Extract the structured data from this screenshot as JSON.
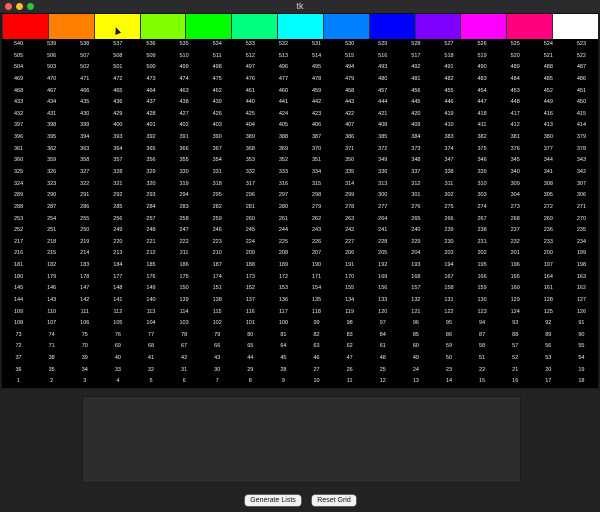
{
  "window": {
    "title": "tk"
  },
  "palette": [
    {
      "name": "red",
      "color": "#ff0000"
    },
    {
      "name": "orange",
      "color": "#ff7f00"
    },
    {
      "name": "yellow",
      "color": "#ffff00"
    },
    {
      "name": "yellow-green",
      "color": "#7fff00"
    },
    {
      "name": "green",
      "color": "#00ff00"
    },
    {
      "name": "spring-green",
      "color": "#00ff7f"
    },
    {
      "name": "cyan",
      "color": "#00ffff"
    },
    {
      "name": "azure",
      "color": "#007fff"
    },
    {
      "name": "blue",
      "color": "#0000ff"
    },
    {
      "name": "violet",
      "color": "#7f00ff"
    },
    {
      "name": "magenta",
      "color": "#ff00ff"
    },
    {
      "name": "rose",
      "color": "#ff007f"
    },
    {
      "name": "white",
      "color": "#ffffff"
    }
  ],
  "grid": {
    "columns": 18,
    "rows": 30,
    "max_value": 540,
    "order": "row 1 at top counts down 540..523; bottom row counts 1..18; alternate rows reverse (boustrophedon)"
  },
  "buttons": {
    "generate": "Generate Lists",
    "reset": "Reset Grid"
  }
}
